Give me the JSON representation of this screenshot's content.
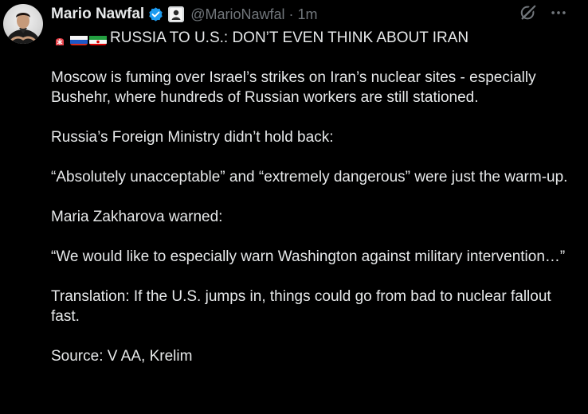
{
  "author": {
    "name": "Mario Nawfal",
    "handle": "@MarioNawfal",
    "separator": "·",
    "time": "1m",
    "verified_icon": "verified-badge-icon",
    "affiliation_icon": "affiliate-badge-icon",
    "avatar_icon": "avatar"
  },
  "icons": {
    "grok": "grok-icon",
    "more": "more-options-icon"
  },
  "colors": {
    "background": "#000000",
    "text": "#e7e9ea",
    "muted": "#71767b",
    "verified": "#1d9bf0"
  },
  "tweet": {
    "headline_emojis": [
      "siren-emoji",
      "russia-flag-emoji",
      "iran-flag-emoji"
    ],
    "headline": "RUSSIA TO U.S.: DON’T EVEN THINK ABOUT IRAN",
    "paragraphs": [
      "Moscow is fuming over Israel’s strikes on Iran’s nuclear sites - especially Bushehr, where hundreds of Russian workers are still stationed.",
      "Russia’s Foreign Ministry didn’t hold back:",
      "“Absolutely unacceptable” and “extremely dangerous” were just the warm-up.",
      "Maria Zakharova warned:",
      "“We would like to especially warn Washington against military intervention…”",
      "Translation: If the U.S. jumps in, things could go from bad to nuclear fallout fast.",
      "Source: V AA, Krelim"
    ]
  }
}
